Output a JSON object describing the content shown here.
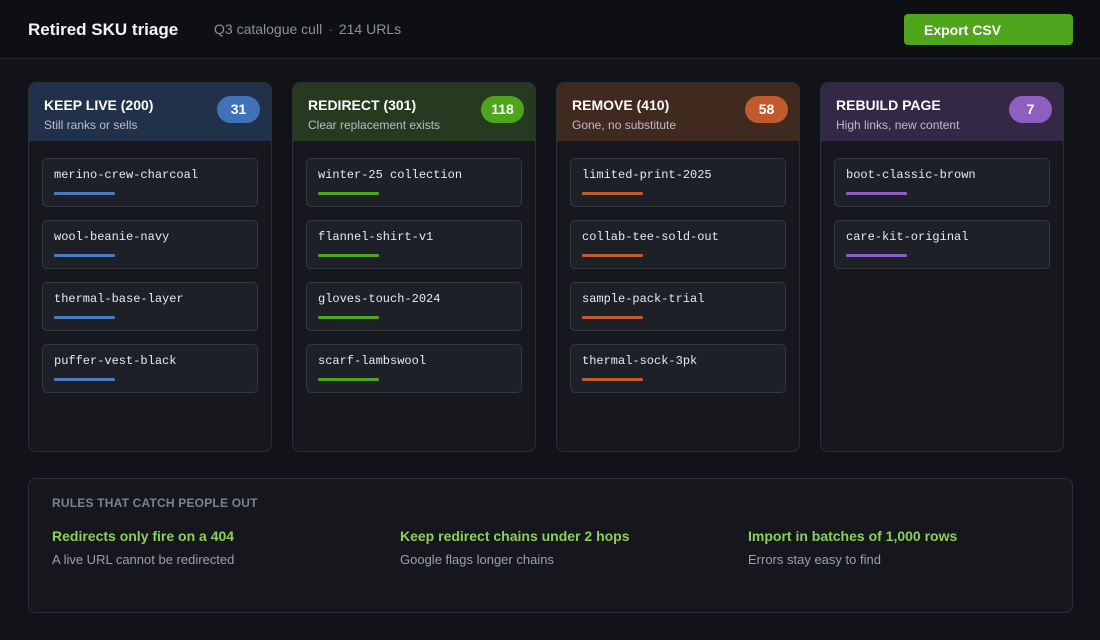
{
  "header": {
    "title": "Retired SKU triage",
    "subtitle": "Q3 catalogue cull",
    "separator": "·",
    "url_count": "214 URLs",
    "export_label": "Export CSV"
  },
  "colors": {
    "accent_green": "#4fa61c",
    "keep_live": "#4a7bc0",
    "redirect": "#4fa61c",
    "remove": "#c15a2c",
    "rebuild": "#8e5ec2"
  },
  "columns": [
    {
      "title": "KEEP LIVE (200)",
      "description": "Still ranks or sells",
      "count": "31",
      "header_bg": "#22314a",
      "badge_color": "#3f72b8",
      "accent": "#4a7bc0",
      "cards": [
        "merino-crew-charcoal",
        "wool-beanie-navy",
        "thermal-base-layer",
        "puffer-vest-black"
      ]
    },
    {
      "title": "REDIRECT (301)",
      "description": "Clear replacement exists",
      "count": "118",
      "header_bg": "#263a1f",
      "badge_color": "#4fa61c",
      "accent": "#4fa61c",
      "cards": [
        "winter-25 collection",
        "flannel-shirt-v1",
        "gloves-touch-2024",
        "scarf-lambswool"
      ]
    },
    {
      "title": "REMOVE (410)",
      "description": "Gone, no substitute",
      "count": "58",
      "header_bg": "#40291f",
      "badge_color": "#c15a2c",
      "accent": "#c15a2c",
      "cards": [
        "limited-print-2025",
        "collab-tee-sold-out",
        "sample-pack-trial",
        "thermal-sock-3pk"
      ]
    },
    {
      "title": "REBUILD PAGE",
      "description": "High links, new content",
      "count": "7",
      "header_bg": "#332846",
      "badge_color": "#8e5ec2",
      "accent": "#8e5ec2",
      "cards": [
        "boot-classic-brown",
        "care-kit-original"
      ]
    }
  ],
  "rules": {
    "title": "RULES THAT CATCH PEOPLE OUT",
    "items": [
      {
        "title": "Redirects only fire on a 404",
        "description": "A live URL cannot be redirected"
      },
      {
        "title": "Keep redirect chains under 2 hops",
        "description": "Google flags longer chains"
      },
      {
        "title": "Import in batches of 1,000 rows",
        "description": "Errors stay easy to find"
      }
    ]
  }
}
